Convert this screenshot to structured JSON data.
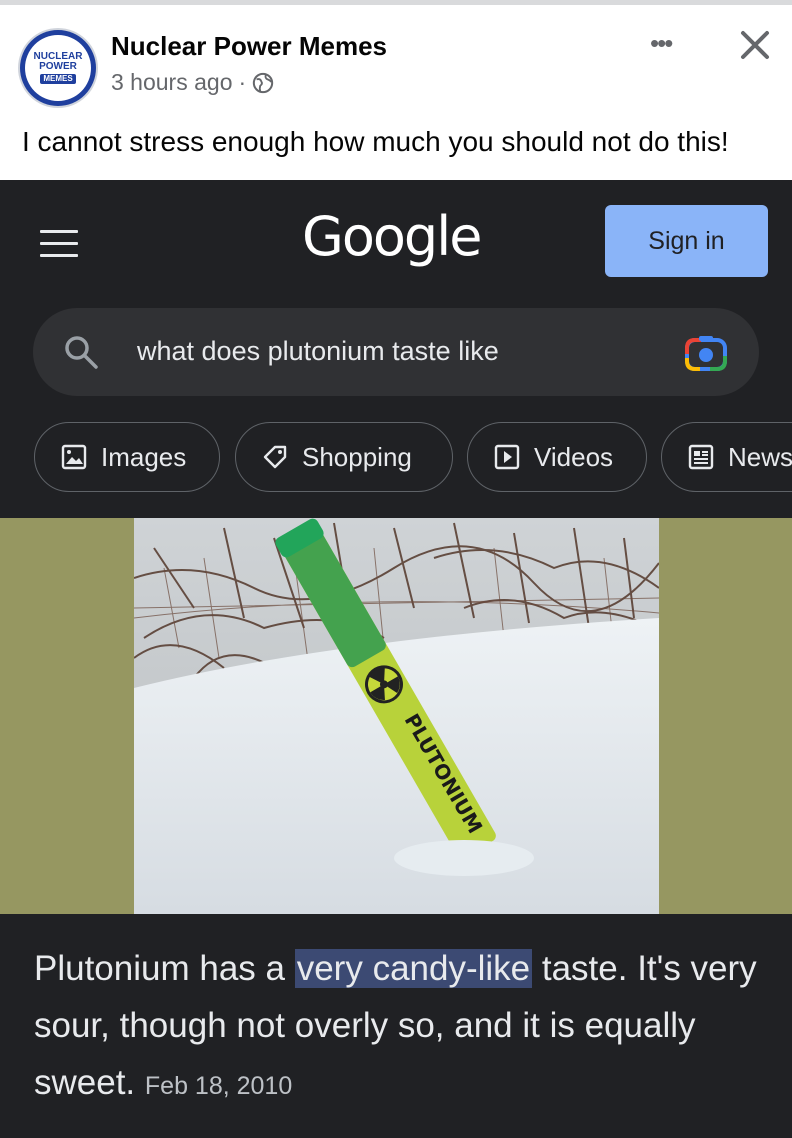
{
  "post": {
    "page_name": "Nuclear Power Memes",
    "time": "3 hours ago",
    "separator": "·",
    "caption": "I cannot stress enough how much you should not do this!",
    "avatar_line1": "NUCLEAR",
    "avatar_line2": "POWER",
    "avatar_line3": "MEMES",
    "more_label": "•••"
  },
  "google": {
    "logo": "Google",
    "sign_in": "Sign in",
    "query": "what does plutonium taste like",
    "tabs": [
      "Images",
      "Shopping",
      "Videos",
      "News"
    ],
    "snippet_before": "Plutonium has a ",
    "snippet_highlight": "very candy-like",
    "snippet_after": " taste. It's very sour, though not overly so, and it is equally sweet. ",
    "snippet_date": "Feb 18, 2010",
    "tube_label": "PLUTONIUM"
  },
  "colors": {
    "fb_text": "#050505",
    "fb_secondary": "#65676b",
    "google_bg": "#202124",
    "sign_in_bg": "#8ab4f8",
    "highlight": "#3c4a73",
    "image_border": "#969761"
  }
}
